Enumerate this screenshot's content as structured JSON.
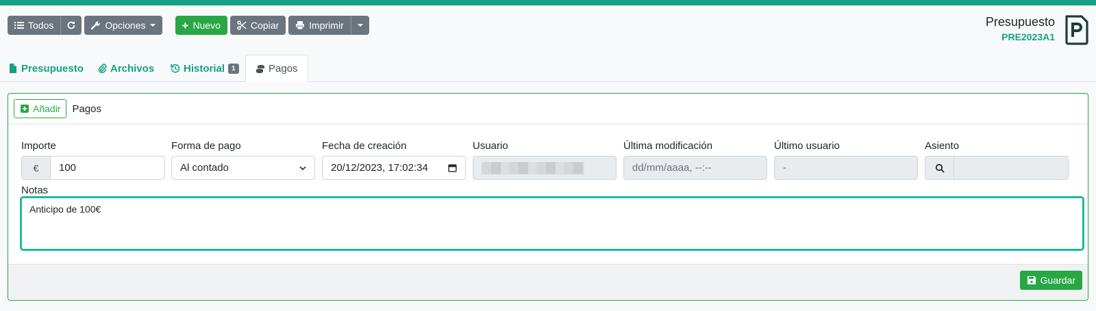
{
  "colors": {
    "accent": "#16a085",
    "success": "#28a745",
    "secondary": "#6c757d"
  },
  "toolbar": {
    "all_label": "Todos",
    "refresh_icon": "refresh-icon",
    "options_label": "Opciones",
    "new_label": "Nuevo",
    "copy_label": "Copiar",
    "print_label": "Imprimir"
  },
  "header": {
    "title": "Presupuesto",
    "code": "PRE2023A1",
    "icon": "document-p-icon"
  },
  "tabs": [
    {
      "label": "Presupuesto",
      "icon": "file-icon"
    },
    {
      "label": "Archivos",
      "icon": "paperclip-icon"
    },
    {
      "label": "Historial",
      "icon": "history-icon",
      "badge": "1"
    },
    {
      "label": "Pagos",
      "icon": "coins-icon",
      "active": true
    }
  ],
  "payments": {
    "add_label": "Añadir",
    "title": "Pagos",
    "fields": {
      "amount": {
        "label": "Importe",
        "currency": "€",
        "value": "100"
      },
      "method": {
        "label": "Forma de pago",
        "value": "Al contado"
      },
      "created": {
        "label": "Fecha de creación",
        "value": "20/12/2023, 17:02:34"
      },
      "user": {
        "label": "Usuario",
        "value": ""
      },
      "modified": {
        "label": "Última modificación",
        "value": "dd/mm/aaaa, --:--"
      },
      "last_user": {
        "label": "Último usuario",
        "value": "-"
      },
      "entry": {
        "label": "Asiento",
        "value": ""
      }
    },
    "notes": {
      "label": "Notas",
      "value": "Anticipo de 100€"
    },
    "save_label": "Guardar"
  }
}
